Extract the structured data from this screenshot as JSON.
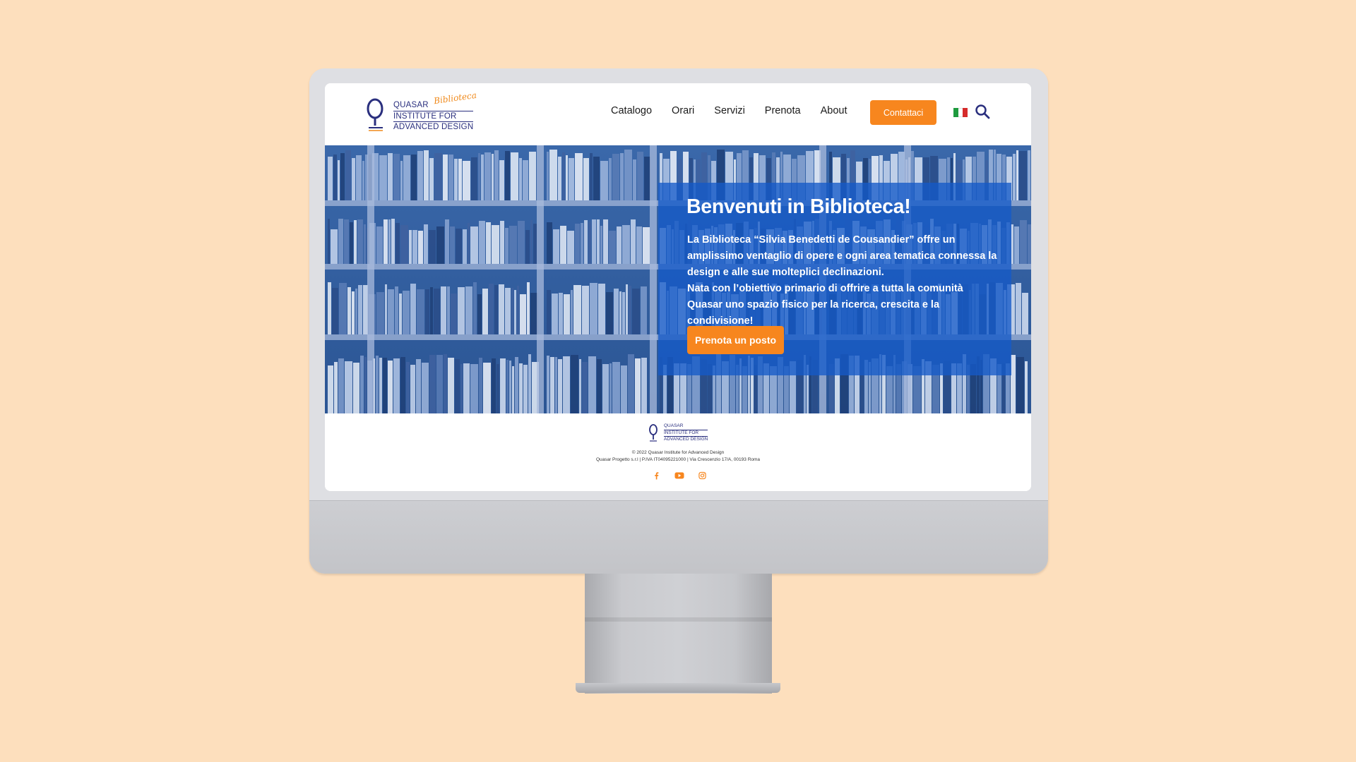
{
  "brand": {
    "line1": "QUASAR",
    "line2": "INSTITUTE FOR",
    "line3": "ADVANCED DESIGN",
    "tagline": "Biblioteca"
  },
  "nav": {
    "items": [
      "Catalogo",
      "Orari",
      "Servizi",
      "Prenota",
      "About"
    ],
    "contact_label": "Contattaci"
  },
  "hero": {
    "title": "Benvenuti in Biblioteca!",
    "paragraph1": "La Biblioteca “Silvia Benedetti de Cousandier” offre un amplissimo ventaglio di opere e ogni area tematica connessa la design e alle sue molteplici declinazioni.",
    "paragraph2": "Nata con l’obiettivo primario di offrire a tutta la comunità Quasar uno spazio fisico per la ricerca, crescita e la condivisione!",
    "button_label": "Prenota un posto"
  },
  "footer": {
    "copyright": "© 2022 Quasar Institute for Advanced Design",
    "company": "Quasar Progetto s.r.l | P.IVA IT04095221000 | Via Crescenzio 17/A, 00193 Roma"
  },
  "icons": {
    "flag": "italy-flag-icon",
    "search": "search-icon",
    "socials": [
      "facebook-icon",
      "youtube-icon",
      "instagram-icon"
    ]
  },
  "colors": {
    "accent": "#f7861e",
    "brand": "#2a2f7e",
    "hero_overlay": "#145ac8",
    "page_bg": "#fddfbd"
  }
}
